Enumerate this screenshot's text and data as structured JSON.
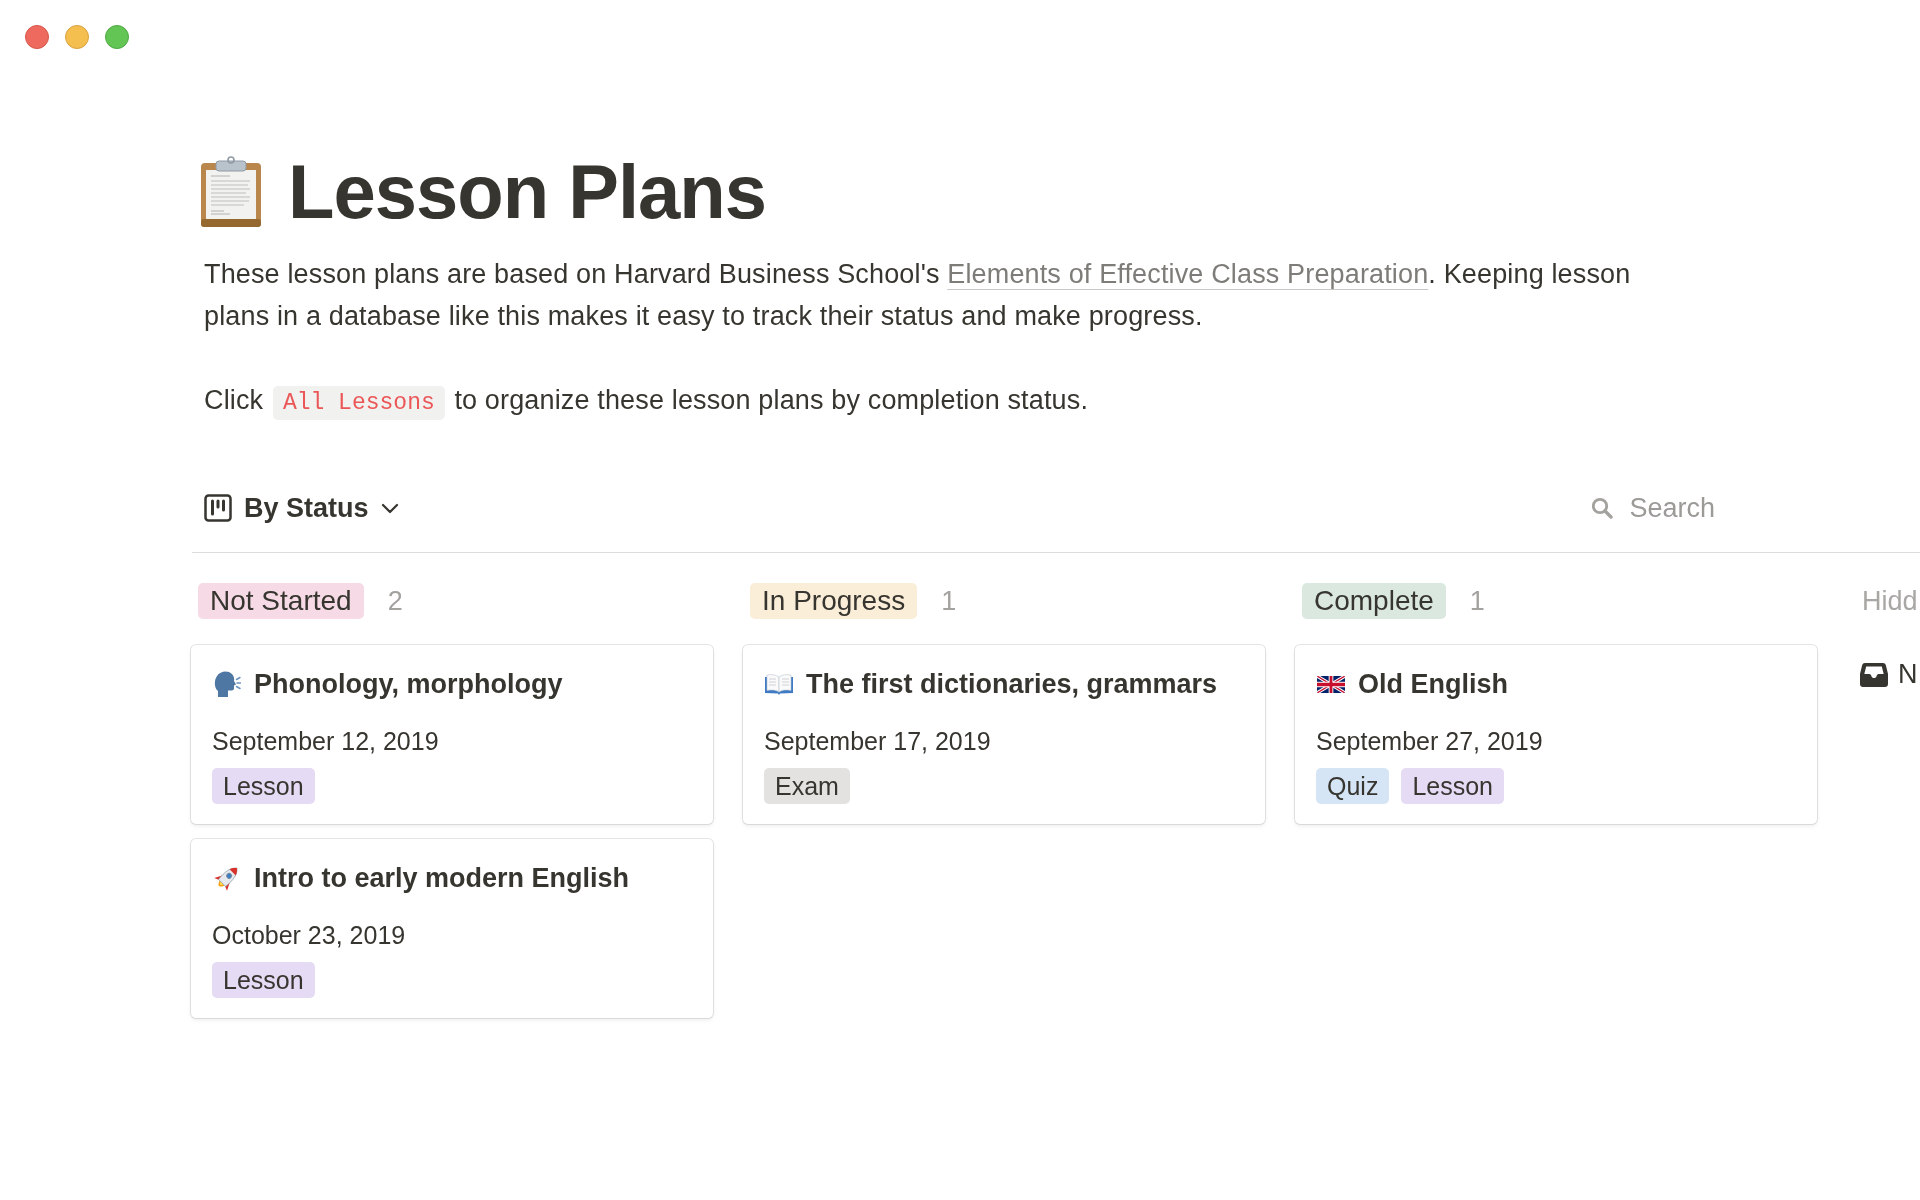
{
  "page": {
    "title": "Lesson Plans"
  },
  "description": {
    "before": "These lesson plans are based on Harvard Business School's ",
    "link": "Elements of Effective Class Preparation",
    "after": ". Keeping lesson plans in a database like this makes it easy to track their status and make progress."
  },
  "hint": {
    "before": "Click ",
    "code": "All Lessons",
    "after": " to organize these lesson plans by completion status."
  },
  "toolbar": {
    "view": "By Status",
    "search": "Search"
  },
  "board": {
    "columns": [
      {
        "status": "Not Started",
        "color": "#f6dbe7",
        "count": "2",
        "cards": [
          {
            "title": "Phonology, morphology",
            "date": "September 12, 2019",
            "tags": [
              {
                "label": "Lesson",
                "color": "#e5dbf5"
              }
            ]
          },
          {
            "title": "Intro to early modern English",
            "date": "October 23, 2019",
            "tags": [
              {
                "label": "Lesson",
                "color": "#e5dbf5"
              }
            ]
          }
        ]
      },
      {
        "status": "In Progress",
        "color": "#fbeed8",
        "count": "1",
        "cards": [
          {
            "title": "The first dictionaries, grammars",
            "date": "September 17, 2019",
            "tags": [
              {
                "label": "Exam",
                "color": "#e3e2e0"
              }
            ]
          }
        ]
      },
      {
        "status": "Complete",
        "color": "#dae8e0",
        "count": "1",
        "cards": [
          {
            "title": "Old English",
            "date": "September 27, 2019",
            "tags": [
              {
                "label": "Quiz",
                "color": "#d6e5f5"
              },
              {
                "label": "Lesson",
                "color": "#e5dbf5"
              }
            ]
          }
        ]
      }
    ],
    "hidden_group": {
      "title": "Hidd",
      "items": [
        {
          "title": "N"
        }
      ]
    }
  }
}
